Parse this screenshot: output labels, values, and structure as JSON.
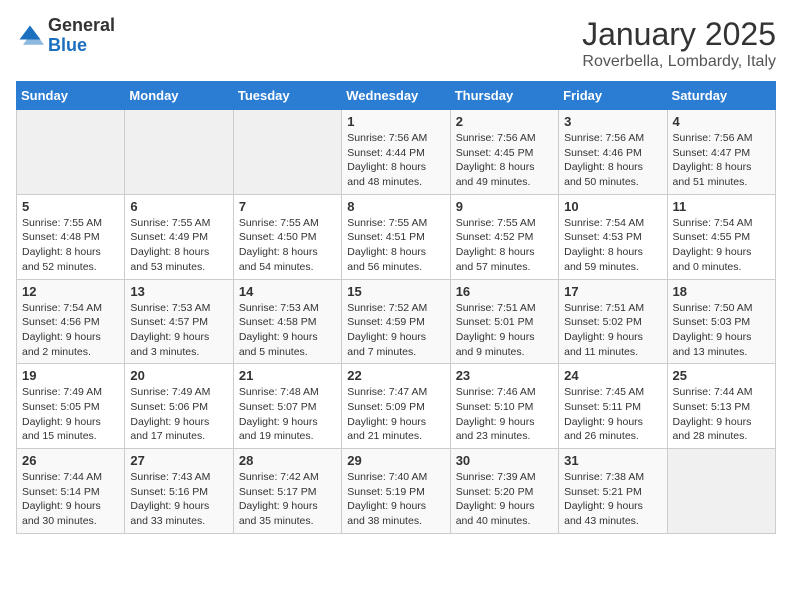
{
  "logo": {
    "general": "General",
    "blue": "Blue"
  },
  "title": "January 2025",
  "subtitle": "Roverbella, Lombardy, Italy",
  "days_of_week": [
    "Sunday",
    "Monday",
    "Tuesday",
    "Wednesday",
    "Thursday",
    "Friday",
    "Saturday"
  ],
  "weeks": [
    [
      {
        "day": "",
        "info": ""
      },
      {
        "day": "",
        "info": ""
      },
      {
        "day": "",
        "info": ""
      },
      {
        "day": "1",
        "info": "Sunrise: 7:56 AM\nSunset: 4:44 PM\nDaylight: 8 hours\nand 48 minutes."
      },
      {
        "day": "2",
        "info": "Sunrise: 7:56 AM\nSunset: 4:45 PM\nDaylight: 8 hours\nand 49 minutes."
      },
      {
        "day": "3",
        "info": "Sunrise: 7:56 AM\nSunset: 4:46 PM\nDaylight: 8 hours\nand 50 minutes."
      },
      {
        "day": "4",
        "info": "Sunrise: 7:56 AM\nSunset: 4:47 PM\nDaylight: 8 hours\nand 51 minutes."
      }
    ],
    [
      {
        "day": "5",
        "info": "Sunrise: 7:55 AM\nSunset: 4:48 PM\nDaylight: 8 hours\nand 52 minutes."
      },
      {
        "day": "6",
        "info": "Sunrise: 7:55 AM\nSunset: 4:49 PM\nDaylight: 8 hours\nand 53 minutes."
      },
      {
        "day": "7",
        "info": "Sunrise: 7:55 AM\nSunset: 4:50 PM\nDaylight: 8 hours\nand 54 minutes."
      },
      {
        "day": "8",
        "info": "Sunrise: 7:55 AM\nSunset: 4:51 PM\nDaylight: 8 hours\nand 56 minutes."
      },
      {
        "day": "9",
        "info": "Sunrise: 7:55 AM\nSunset: 4:52 PM\nDaylight: 8 hours\nand 57 minutes."
      },
      {
        "day": "10",
        "info": "Sunrise: 7:54 AM\nSunset: 4:53 PM\nDaylight: 8 hours\nand 59 minutes."
      },
      {
        "day": "11",
        "info": "Sunrise: 7:54 AM\nSunset: 4:55 PM\nDaylight: 9 hours\nand 0 minutes."
      }
    ],
    [
      {
        "day": "12",
        "info": "Sunrise: 7:54 AM\nSunset: 4:56 PM\nDaylight: 9 hours\nand 2 minutes."
      },
      {
        "day": "13",
        "info": "Sunrise: 7:53 AM\nSunset: 4:57 PM\nDaylight: 9 hours\nand 3 minutes."
      },
      {
        "day": "14",
        "info": "Sunrise: 7:53 AM\nSunset: 4:58 PM\nDaylight: 9 hours\nand 5 minutes."
      },
      {
        "day": "15",
        "info": "Sunrise: 7:52 AM\nSunset: 4:59 PM\nDaylight: 9 hours\nand 7 minutes."
      },
      {
        "day": "16",
        "info": "Sunrise: 7:51 AM\nSunset: 5:01 PM\nDaylight: 9 hours\nand 9 minutes."
      },
      {
        "day": "17",
        "info": "Sunrise: 7:51 AM\nSunset: 5:02 PM\nDaylight: 9 hours\nand 11 minutes."
      },
      {
        "day": "18",
        "info": "Sunrise: 7:50 AM\nSunset: 5:03 PM\nDaylight: 9 hours\nand 13 minutes."
      }
    ],
    [
      {
        "day": "19",
        "info": "Sunrise: 7:49 AM\nSunset: 5:05 PM\nDaylight: 9 hours\nand 15 minutes."
      },
      {
        "day": "20",
        "info": "Sunrise: 7:49 AM\nSunset: 5:06 PM\nDaylight: 9 hours\nand 17 minutes."
      },
      {
        "day": "21",
        "info": "Sunrise: 7:48 AM\nSunset: 5:07 PM\nDaylight: 9 hours\nand 19 minutes."
      },
      {
        "day": "22",
        "info": "Sunrise: 7:47 AM\nSunset: 5:09 PM\nDaylight: 9 hours\nand 21 minutes."
      },
      {
        "day": "23",
        "info": "Sunrise: 7:46 AM\nSunset: 5:10 PM\nDaylight: 9 hours\nand 23 minutes."
      },
      {
        "day": "24",
        "info": "Sunrise: 7:45 AM\nSunset: 5:11 PM\nDaylight: 9 hours\nand 26 minutes."
      },
      {
        "day": "25",
        "info": "Sunrise: 7:44 AM\nSunset: 5:13 PM\nDaylight: 9 hours\nand 28 minutes."
      }
    ],
    [
      {
        "day": "26",
        "info": "Sunrise: 7:44 AM\nSunset: 5:14 PM\nDaylight: 9 hours\nand 30 minutes."
      },
      {
        "day": "27",
        "info": "Sunrise: 7:43 AM\nSunset: 5:16 PM\nDaylight: 9 hours\nand 33 minutes."
      },
      {
        "day": "28",
        "info": "Sunrise: 7:42 AM\nSunset: 5:17 PM\nDaylight: 9 hours\nand 35 minutes."
      },
      {
        "day": "29",
        "info": "Sunrise: 7:40 AM\nSunset: 5:19 PM\nDaylight: 9 hours\nand 38 minutes."
      },
      {
        "day": "30",
        "info": "Sunrise: 7:39 AM\nSunset: 5:20 PM\nDaylight: 9 hours\nand 40 minutes."
      },
      {
        "day": "31",
        "info": "Sunrise: 7:38 AM\nSunset: 5:21 PM\nDaylight: 9 hours\nand 43 minutes."
      },
      {
        "day": "",
        "info": ""
      }
    ]
  ]
}
